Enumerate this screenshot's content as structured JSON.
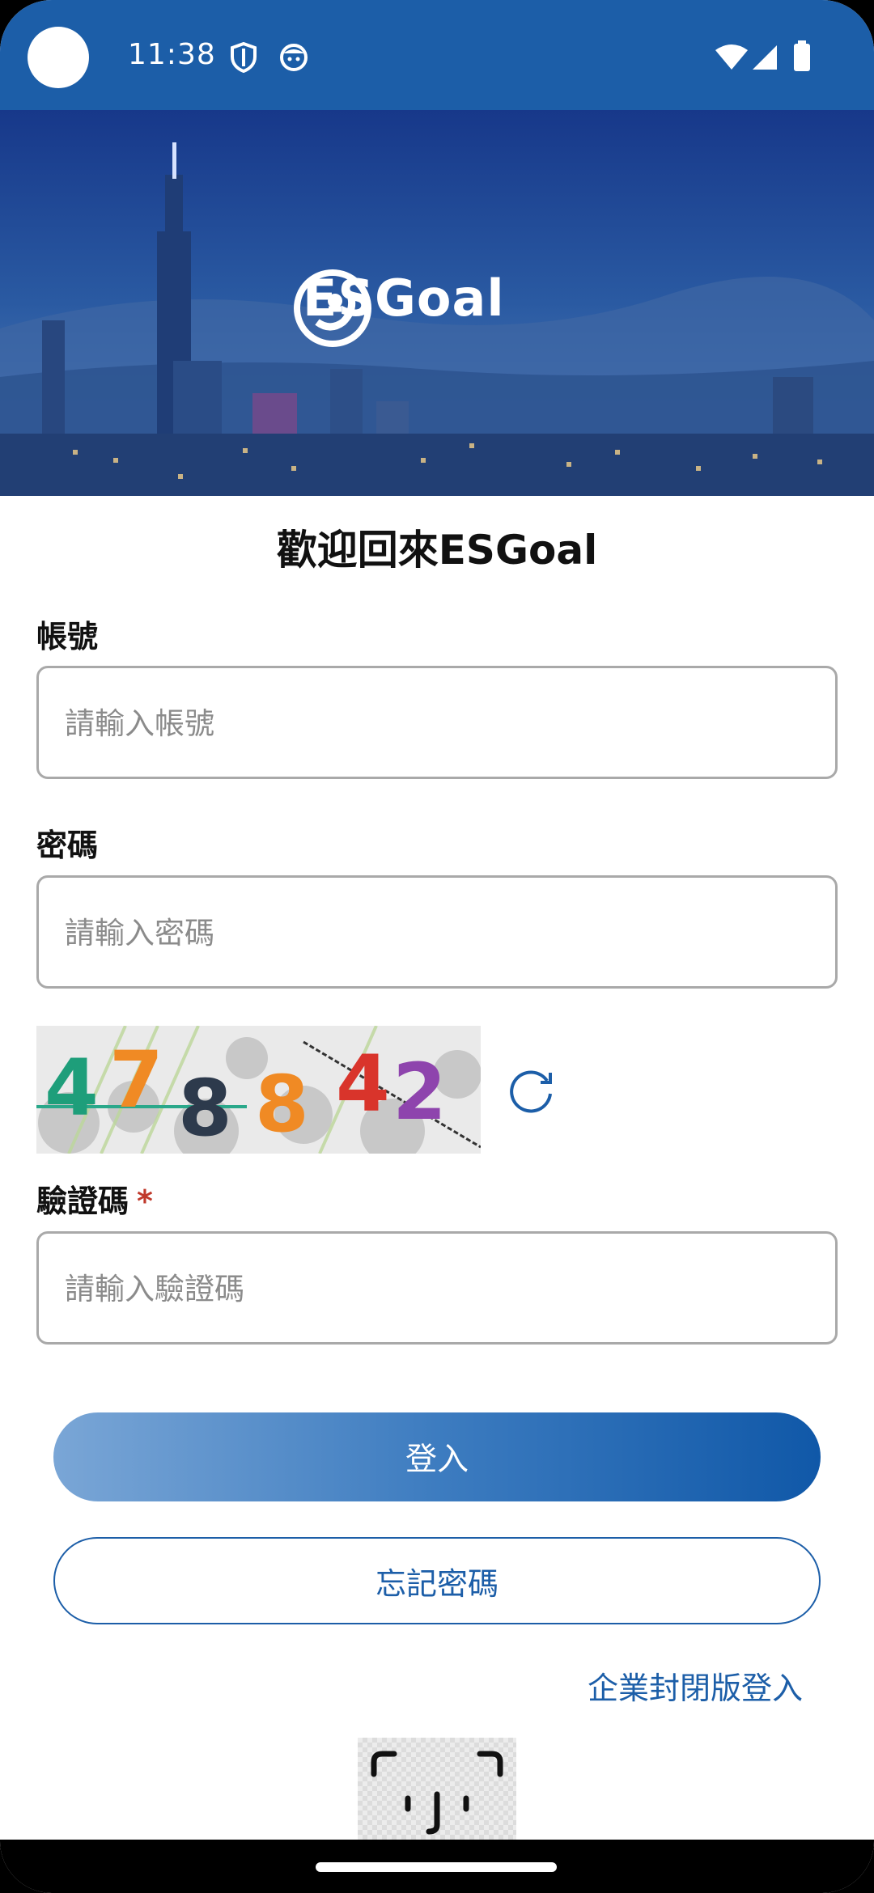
{
  "status_bar": {
    "time": "11:38",
    "left_icons": [
      "camera-dot",
      "shield-icon",
      "face-icon"
    ],
    "right_icons": [
      "wifi-icon",
      "signal-icon",
      "battery-icon"
    ],
    "background": "#1c5ea8"
  },
  "hero": {
    "logo_text": "ESGoal",
    "logo_ring_text": "ESGoal"
  },
  "login": {
    "title": "歡迎回來ESGoal",
    "account_label": "帳號",
    "account_placeholder": "請輸入帳號",
    "account_value": "",
    "password_label": "密碼",
    "password_placeholder": "請輸入密碼",
    "password_value": "",
    "captcha_digits": [
      "4",
      "7",
      "8",
      "8",
      "4",
      "2"
    ],
    "captcha_label": "驗證碼",
    "captcha_required_mark": "*",
    "captcha_placeholder": "請輸入驗證碼",
    "captcha_value": "",
    "login_button": "登入",
    "forgot_button": "忘記密碼",
    "enterprise_link": "企業封閉版登入"
  },
  "colors": {
    "accent": "#1c5ea8",
    "required": "#c0392b"
  }
}
